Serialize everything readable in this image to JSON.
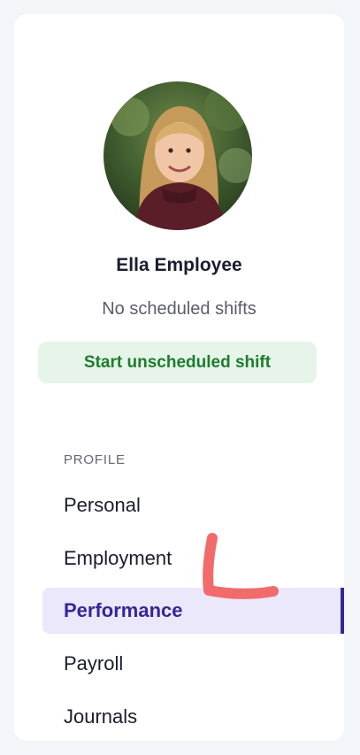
{
  "profile": {
    "name": "Ella Employee",
    "shift_status": "No scheduled shifts",
    "start_shift_label": "Start unscheduled shift"
  },
  "nav": {
    "section_label": "PROFILE",
    "items": [
      {
        "label": "Personal",
        "active": false
      },
      {
        "label": "Employment",
        "active": false
      },
      {
        "label": "Performance",
        "active": true
      },
      {
        "label": "Payroll",
        "active": false
      },
      {
        "label": "Journals",
        "active": false
      }
    ]
  },
  "colors": {
    "accent": "#35279a",
    "active_bg": "#ebe8fb",
    "success_text": "#1e7d2c",
    "success_bg": "#e6f4ea",
    "annotation": "#f26b6b"
  }
}
